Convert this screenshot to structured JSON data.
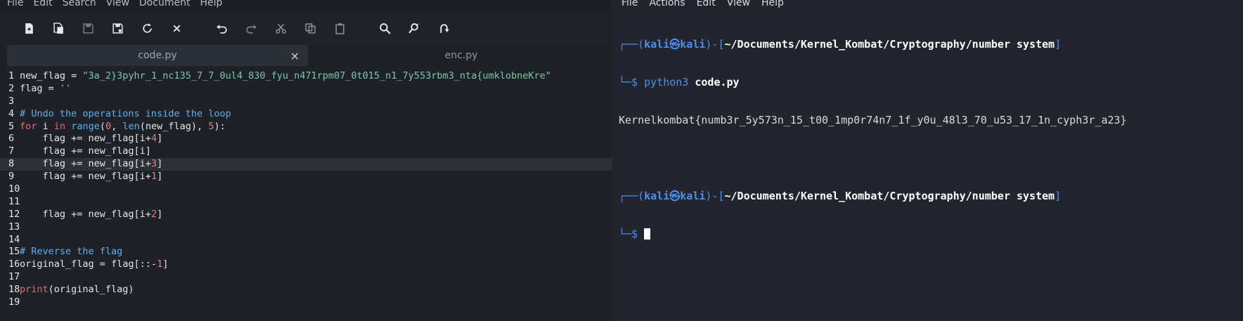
{
  "editor": {
    "menu": [
      "File",
      "Edit",
      "Search",
      "View",
      "Document",
      "Help"
    ],
    "toolbar_icons": [
      "new-file-icon",
      "new-window-icon",
      "save-icon",
      "save-as-icon",
      "reload-icon",
      "close-icon",
      "undo-icon",
      "redo-icon",
      "cut-icon",
      "copy-icon",
      "paste-icon",
      "find-icon",
      "find-replace-icon",
      "goto-icon"
    ],
    "tabs": [
      {
        "label": "code.py",
        "close": "×",
        "active": true
      },
      {
        "label": "enc.py",
        "active": false
      }
    ],
    "highlighted_line": 8,
    "lines": [
      {
        "n": "1",
        "segments": [
          {
            "t": "new_flag = "
          },
          {
            "t": "\"3a_2}3pyhr_1_nc135_7_7_0ul4_830_fyu_n471rpm07_0t015_n1_7y553rbm3_nta{umklobneKre\"",
            "c": "str"
          }
        ]
      },
      {
        "n": "2",
        "segments": [
          {
            "t": "flag = "
          },
          {
            "t": "''",
            "c": "str"
          }
        ]
      },
      {
        "n": "3",
        "segments": []
      },
      {
        "n": "4",
        "segments": [
          {
            "t": "# Undo the operations inside the loop",
            "c": "cm"
          }
        ]
      },
      {
        "n": "5",
        "segments": [
          {
            "t": "for",
            "c": "kw"
          },
          {
            "t": " i "
          },
          {
            "t": "in",
            "c": "kw"
          },
          {
            "t": " "
          },
          {
            "t": "range",
            "c": "fn"
          },
          {
            "t": "("
          },
          {
            "t": "0",
            "c": "num"
          },
          {
            "t": ", "
          },
          {
            "t": "len",
            "c": "fn"
          },
          {
            "t": "(new_flag), "
          },
          {
            "t": "5",
            "c": "num"
          },
          {
            "t": "):"
          }
        ]
      },
      {
        "n": "6",
        "segments": [
          {
            "t": "    flag += new_flag[i+"
          },
          {
            "t": "4",
            "c": "num"
          },
          {
            "t": "]"
          }
        ]
      },
      {
        "n": "7",
        "segments": [
          {
            "t": "    flag += new_flag[i]"
          }
        ]
      },
      {
        "n": "8",
        "segments": [
          {
            "t": "    flag += new_flag[i+"
          },
          {
            "t": "3",
            "c": "num"
          },
          {
            "t": "]"
          }
        ]
      },
      {
        "n": "9",
        "segments": [
          {
            "t": "    flag += new_flag[i+"
          },
          {
            "t": "1",
            "c": "num"
          },
          {
            "t": "]"
          }
        ]
      },
      {
        "n": "10",
        "segments": []
      },
      {
        "n": "11",
        "segments": []
      },
      {
        "n": "12",
        "segments": [
          {
            "t": "    flag += new_flag[i+"
          },
          {
            "t": "2",
            "c": "num"
          },
          {
            "t": "]"
          }
        ]
      },
      {
        "n": "13",
        "segments": []
      },
      {
        "n": "14",
        "segments": []
      },
      {
        "n": "15",
        "segments": [
          {
            "t": "# Reverse the flag",
            "c": "cm"
          }
        ]
      },
      {
        "n": "16",
        "segments": [
          {
            "t": "original_flag = flag[::-"
          },
          {
            "t": "1",
            "c": "num"
          },
          {
            "t": "]"
          }
        ]
      },
      {
        "n": "17",
        "segments": []
      },
      {
        "n": "18",
        "segments": [
          {
            "t": "print",
            "c": "kw"
          },
          {
            "t": "(original_flag)"
          }
        ]
      },
      {
        "n": "19",
        "segments": []
      }
    ]
  },
  "terminal": {
    "menu": [
      "File",
      "Actions",
      "Edit",
      "View",
      "Help"
    ],
    "prompt_box": "┌──(",
    "user": "kali",
    "at": "㉿",
    "host": "kali",
    "bracket_mid": ")-[",
    "path": "~/Documents/Kernel_Kombat/Cryptography/number system",
    "bracket_close": "]",
    "prompt_end": "└─$",
    "cmd_name": "python3",
    "cmd_arg": "code.py",
    "output": "Kernelkombat{numb3r_5y573n_15_t00_1mp0r74n7_1f_y0u_48l3_70_u53_17_1n_cyph3r_a23}"
  }
}
